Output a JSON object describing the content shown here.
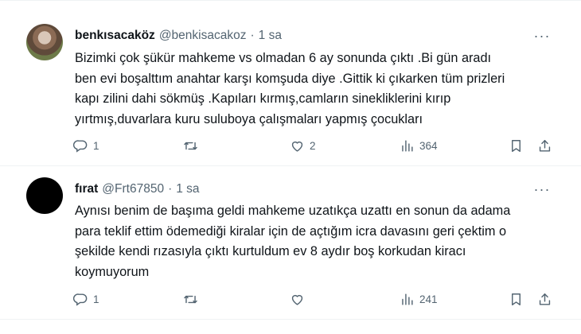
{
  "tweets": [
    {
      "display_name": "benkısacaköz",
      "handle": "@benkisacakoz",
      "separator": "·",
      "time": "1 sa",
      "more": "···",
      "text_lines": [
        "Bizimki çok şükür mahkeme vs olmadan 6 ay sonunda çıktı .Bi gün aradı",
        "ben evi boşalttım anahtar karşı komşuda diye .Gittik ki çıkarken tüm prizleri",
        "kapı zilini dahi sökmüş .Kapıları kırmış,camların sinekliklerini kırıp",
        "yırtmış,duvarlara kuru suluboya çalışmaları yapmış çocukları"
      ],
      "replies": "1",
      "retweets": "",
      "likes": "2",
      "views": "364",
      "avatar": "profile-photo"
    },
    {
      "display_name": "fırat",
      "handle": "@Frt67850",
      "separator": "·",
      "time": "1 sa",
      "more": "···",
      "text_lines": [
        "Aynısı benim de başıma geldi mahkeme uzatıkça uzattı en sonun da adama",
        "para teklif ettim ödemediği kiralar için de açtığım icra davasını geri çektim o",
        "şekilde kendi rızasıyla çıktı kurtuldum ev 8 aydır boş korkudan kiracı",
        "koymuyorum"
      ],
      "replies": "1",
      "retweets": "",
      "likes": "",
      "views": "241",
      "avatar": "black-circle"
    }
  ],
  "icons": {
    "reply": "reply-icon",
    "retweet": "retweet-icon",
    "like": "heart-icon",
    "views": "views-chart-icon",
    "bookmark": "bookmark-icon",
    "share": "share-icon",
    "more": "more-dots-icon"
  },
  "colors": {
    "text": "#0f1419",
    "secondary": "#536471",
    "divider": "#eff3f4",
    "background": "#ffffff"
  }
}
